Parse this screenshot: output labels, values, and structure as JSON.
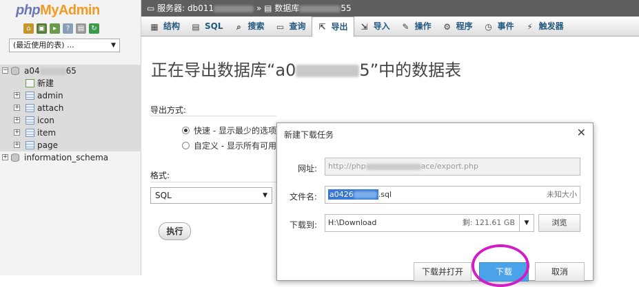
{
  "app": {
    "logo_php": "php",
    "logo_my": "My",
    "logo_admin": "Admin"
  },
  "nav": {
    "recent_label": "(最近使用的表) ...",
    "db_name": "a04",
    "db_name_suffix": "65",
    "new_item": "新建",
    "tables": [
      "admin",
      "attach",
      "icon",
      "item",
      "page"
    ],
    "other_db": "information_schema"
  },
  "topbar": {
    "server_label": "服务器: db011",
    "separator": "»",
    "db_label": "数据库",
    "db_suffix": "55"
  },
  "tabs": [
    {
      "label": "结构",
      "icon": "structure-icon"
    },
    {
      "label": "SQL",
      "icon": "sql-icon"
    },
    {
      "label": "搜索",
      "icon": "search-icon"
    },
    {
      "label": "查询",
      "icon": "query-icon"
    },
    {
      "label": "导出",
      "icon": "export-icon"
    },
    {
      "label": "导入",
      "icon": "import-icon"
    },
    {
      "label": "操作",
      "icon": "wrench-icon"
    },
    {
      "label": "程序",
      "icon": "routines-icon"
    },
    {
      "label": "事件",
      "icon": "clock-icon"
    },
    {
      "label": "触发器",
      "icon": "triggers-icon"
    }
  ],
  "main": {
    "title_prefix": "正在导出数据库“a0",
    "title_suffix": "5”中的数据表",
    "export_method_label": "导出方式:",
    "option_quick": "快速 - 显示最少的选项",
    "option_custom": "自定义 - 显示所有可用",
    "format_label": "格式:",
    "format_value": "SQL",
    "go_label": "执行"
  },
  "dialog": {
    "title": "新建下载任务",
    "url_label": "网址:",
    "url_prefix": "http://php",
    "url_suffix": "ace/export.php",
    "filename_label": "文件名:",
    "filename_selected": "a0426",
    "filename_ext": ".sql",
    "size_hint": "未知大小",
    "saveto_label": "下载到:",
    "path": "H:\\Download",
    "free_space": "剩: 121.61 GB",
    "browse_label": "浏览",
    "open_label": "下载并打开",
    "download_label": "下载",
    "cancel_label": "取消"
  },
  "colors": {
    "topbar": "#5f5f5f",
    "tab_text": "#235a81",
    "download_button": "#4aa3e8",
    "highlight_circle": "#d41cc5"
  }
}
